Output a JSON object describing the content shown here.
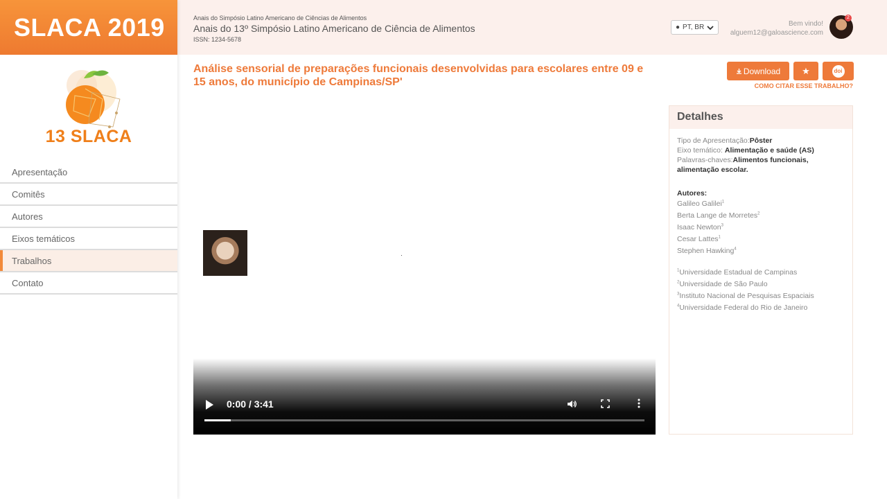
{
  "sidebar": {
    "brand": "SLACA 2019",
    "logo_text": "13 SLACA",
    "nav": [
      {
        "label": "Apresentação"
      },
      {
        "label": "Comitês"
      },
      {
        "label": "Autores"
      },
      {
        "label": "Eixos temáticos"
      },
      {
        "label": "Trabalhos",
        "active": true
      },
      {
        "label": "Contato"
      }
    ]
  },
  "header": {
    "small": "Anais do Simpósio Latino Americano de Ciências de Alimentos",
    "title": "Anais do 13º Simpósio Latino Americano de Ciência de Alimentos",
    "issn": "ISSN: 1234-5678",
    "lang": "PT, BR",
    "welcome": "Bem vindo!",
    "email": "alguem12@galoascience.com",
    "notif_count": "2"
  },
  "work": {
    "title": "Análise sensorial de preparações funcionais desenvolvidas para escolares entre 09 e 15 anos, do município de Campinas/SP'",
    "download": "Download",
    "star": "★",
    "doi": "doi",
    "cite": "COMO CITAR ESSE TRABALHO?"
  },
  "video": {
    "time": "0:00 / 3:41",
    "progress": 0.06
  },
  "details": {
    "heading": "Detalhes",
    "presentation_label": "Tipo de Apresentação:",
    "presentation_value": "Pôster",
    "axis_label": "Eixo temático: ",
    "axis_value": "Alimentação e saúde (AS)",
    "keywords_label": "Palavras-chaves:",
    "keywords_value": "Alimentos funcionais, alimentação escolar.",
    "authors_label": "Autores:",
    "authors": [
      {
        "name": "Galileo Galilei",
        "sup": "1"
      },
      {
        "name": "Berta Lange de Morretes",
        "sup": "2"
      },
      {
        "name": "Isaac Newton",
        "sup": "3"
      },
      {
        "name": "Cesar Lattes",
        "sup": "1"
      },
      {
        "name": "Stephen Hawking",
        "sup": "4"
      }
    ],
    "institutions": [
      {
        "sup": "1",
        "name": "Universidade Estadual de Campinas"
      },
      {
        "sup": "2",
        "name": "Universidade de São Paulo"
      },
      {
        "sup": "3",
        "name": "Instituto Nacional de Pesquisas Espaciais"
      },
      {
        "sup": "4",
        "name": "Universidade Federal do Rio de Janeiro"
      }
    ]
  },
  "colors": {
    "accent": "#ee7a3a",
    "header_bg": "#fcf0ec"
  },
  "icons": [
    "globe-icon",
    "chevron-down-icon",
    "download-icon",
    "star-icon",
    "doi-icon",
    "play-icon",
    "volume-icon",
    "fullscreen-icon",
    "more-options-icon"
  ]
}
